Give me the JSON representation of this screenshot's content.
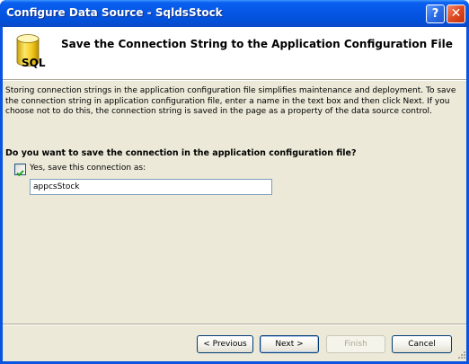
{
  "window": {
    "title": "Configure Data Source - SqldsStock",
    "help_glyph": "?",
    "close_glyph": "✕"
  },
  "header": {
    "icon": "database-cylinder-icon",
    "icon_label": "SQL",
    "title": "Save the Connection String to the Application Configuration File"
  },
  "body": {
    "description": "Storing connection strings in the application configuration file simplifies maintenance and deployment. To save the connection string in application configuration file, enter a name in the text box and then click Next. If you choose not to do this, the connection string is saved in the page as a property of the data source control.",
    "question": "Do you want to save the connection in the application configuration file?",
    "save_checkbox": {
      "checked": true,
      "label": "Yes, save this connection as:"
    },
    "connection_name": "appcsStock"
  },
  "buttons": {
    "previous": "< Previous",
    "next": "Next >",
    "finish": "Finish",
    "cancel": "Cancel"
  },
  "colors": {
    "titlebar": "#0556e4",
    "dialog_face": "#ece9d8",
    "header_bg": "#ffffff",
    "checkmark": "#21a121"
  }
}
